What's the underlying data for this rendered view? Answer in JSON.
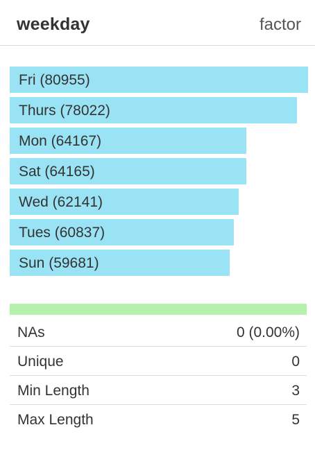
{
  "column": {
    "name": "weekday",
    "type": "factor"
  },
  "colors": {
    "bar": "#9ae3f4",
    "completeness": "#b5f0ad"
  },
  "levels": [
    {
      "label": "Fri (80955)",
      "level": "Fri",
      "count": 80955
    },
    {
      "label": "Thurs (78022)",
      "level": "Thurs",
      "count": 78022
    },
    {
      "label": "Mon (64167)",
      "level": "Mon",
      "count": 64167
    },
    {
      "label": "Sat (64165)",
      "level": "Sat",
      "count": 64165
    },
    {
      "label": "Wed (62141)",
      "level": "Wed",
      "count": 62141
    },
    {
      "label": "Tues (60837)",
      "level": "Tues",
      "count": 60837
    },
    {
      "label": "Sun (59681)",
      "level": "Sun",
      "count": 59681
    }
  ],
  "completeness_fraction": 1.0,
  "stats": [
    {
      "label": "NAs",
      "value": "0 (0.00%)"
    },
    {
      "label": "Unique",
      "value": "0"
    },
    {
      "label": "Min Length",
      "value": "3"
    },
    {
      "label": "Max Length",
      "value": "5"
    }
  ]
}
